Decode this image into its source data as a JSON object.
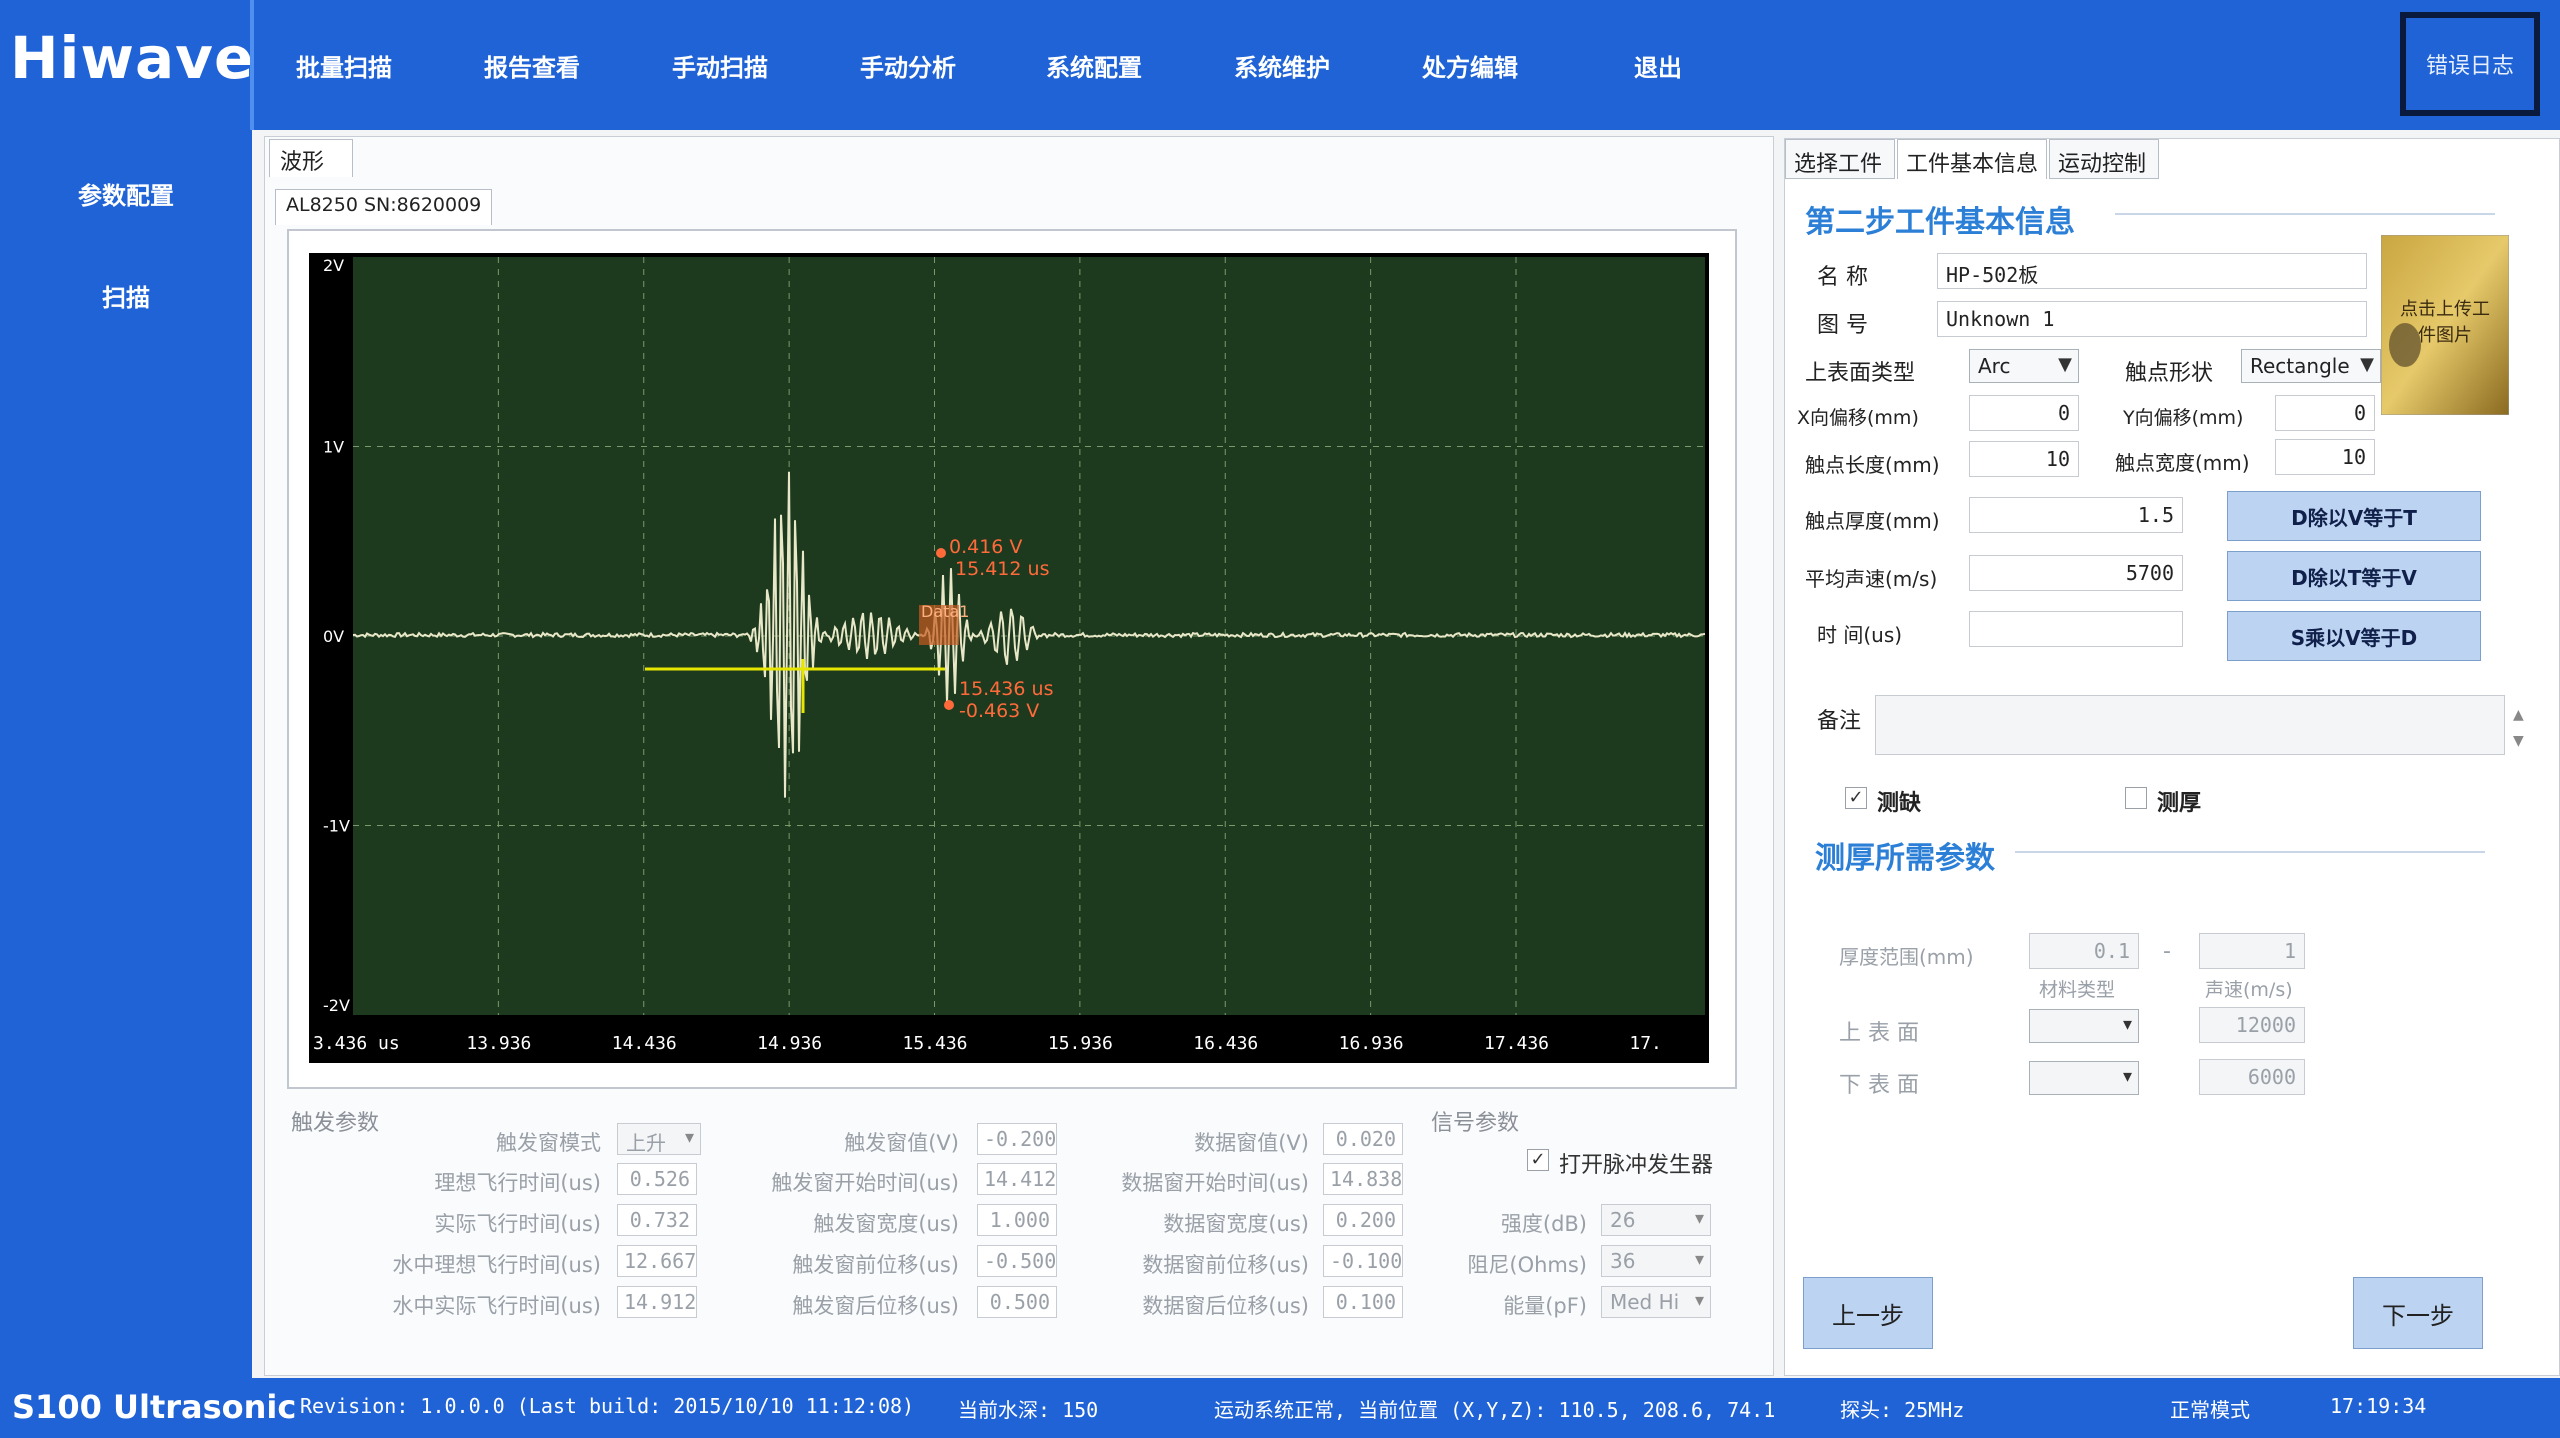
{
  "app": {
    "logo": "Hiwave",
    "error_log": "错误日志",
    "nav": [
      "批量扫描",
      "报告查看",
      "手动扫描",
      "手动分析",
      "系统配置",
      "系统维护",
      "处方编辑",
      "退出"
    ],
    "sidebar": [
      "参数配置",
      "扫描"
    ]
  },
  "wave": {
    "tab": "波形",
    "channel_tab": "AL8250 SN:8620009",
    "y_ticks": [
      "2V",
      "1V",
      "0V",
      "-1V",
      "-2V"
    ],
    "x_ticks": [
      "3.436 us",
      "13.936",
      "14.436",
      "14.936",
      "15.436",
      "15.936",
      "16.436",
      "16.936",
      "17.436",
      "17."
    ],
    "cursor1": [
      "0.416 V",
      "15.412 us"
    ],
    "cursor2": [
      "15.436 us",
      "-0.463 V"
    ],
    "overlay_label": "Data1",
    "colors": {
      "scope_bg": "#1e3a1e",
      "trace": "#e8e8c8",
      "gate": "#e6e600",
      "cursor": "#ff6a3a"
    }
  },
  "trigger": {
    "group_label": "触发参数",
    "mode_label": "触发窗模式",
    "mode_value": "上升",
    "fields_col1": [
      {
        "label": "理想飞行时间(us)",
        "value": "0.526"
      },
      {
        "label": "实际飞行时间(us)",
        "value": "0.732"
      },
      {
        "label": "水中理想飞行时间(us)",
        "value": "12.667"
      },
      {
        "label": "水中实际飞行时间(us)",
        "value": "14.912"
      }
    ],
    "fields_col2": [
      {
        "label": "触发窗值(V)",
        "value": "-0.200"
      },
      {
        "label": "触发窗开始时间(us)",
        "value": "14.412"
      },
      {
        "label": "触发窗宽度(us)",
        "value": "1.000"
      },
      {
        "label": "触发窗前位移(us)",
        "value": "-0.500"
      },
      {
        "label": "触发窗后位移(us)",
        "value": "0.500"
      }
    ],
    "fields_col3": [
      {
        "label": "数据窗值(V)",
        "value": "0.020"
      },
      {
        "label": "数据窗开始时间(us)",
        "value": "14.838"
      },
      {
        "label": "数据窗宽度(us)",
        "value": "0.200"
      },
      {
        "label": "数据窗前位移(us)",
        "value": "-0.100"
      },
      {
        "label": "数据窗后位移(us)",
        "value": "0.100"
      }
    ]
  },
  "signal": {
    "group_label": "信号参数",
    "pulse_label": "打开脉冲发生器",
    "gain_label": "强度(dB)",
    "gain_value": "26",
    "damping_label": "阻尼(Ohms)",
    "damping_value": "36",
    "energy_label": "能量(pF)",
    "energy_value": "Med Hi"
  },
  "right": {
    "tabs": [
      "选择工件",
      "工件基本信息",
      "运动控制"
    ],
    "title": "第二步工件基本信息",
    "name_label": "名    称",
    "name_value": "HP-502板",
    "drawing_label": "图    号",
    "drawing_value": "Unknown 1",
    "surface_label": "上表面类型",
    "surface_value": "Arc",
    "contact_label": "触点形状",
    "contact_value": "Rectangle",
    "xoff_label": "X向偏移(mm)",
    "xoff_value": "0",
    "yoff_label": "Y向偏移(mm)",
    "yoff_value": "0",
    "clen_label": "触点长度(mm)",
    "clen_value": "10",
    "cwid_label": "触点宽度(mm)",
    "cwid_value": "10",
    "cthk_label": "触点厚度(mm)",
    "cthk_value": "1.5",
    "vel_label": "平均声速(m/s)",
    "vel_value": "5700",
    "time_label": "时    间(us)",
    "time_value": "",
    "btn_t": "D除以V等于T",
    "btn_v": "D除以T等于V",
    "btn_d": "S乘以V等于D",
    "photo_text": "点击上传工件图片",
    "remark_label": "备注",
    "chk_defect": "测缺",
    "chk_defect_checked": true,
    "chk_thick": "测厚",
    "chk_thick_checked": false,
    "thick_title": "测厚所需参数",
    "range_label": "厚度范围(mm)",
    "range_min": "0.1",
    "range_max": "1",
    "mat_label": "材料类型",
    "speed_label": "声速(m/s)",
    "upper_label": "上 表 面",
    "upper_speed": "12000",
    "lower_label": "下 表 面",
    "lower_speed": "6000",
    "prev": "上一步",
    "next": "下一步"
  },
  "status": {
    "title": "S100 Ultrasonic",
    "revision": "Revision: 1.0.0.0 (Last build: 2015/10/10 11:12:08)",
    "water": "当前水深: 150",
    "motion": "运动系统正常, 当前位置 (X,Y,Z): 110.5, 208.6, 74.1",
    "probe": "探头: 25MHz",
    "mode": "正常模式",
    "time": "17:19:34"
  }
}
